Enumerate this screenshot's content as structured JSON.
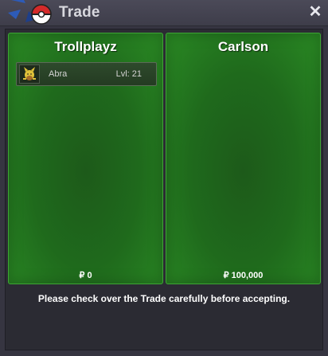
{
  "window": {
    "title": "Trade",
    "close_icon": "close-icon",
    "title_icon": "pokeball-arrows-icon"
  },
  "left_panel": {
    "player_name": "Trollplayz",
    "items": [
      {
        "name": "Abra",
        "level": "Lvl: 21",
        "icon": "abra-sprite-icon"
      }
    ],
    "money": "₽ 0"
  },
  "right_panel": {
    "player_name": "Carlson",
    "items": [],
    "money": "₽ 100,000"
  },
  "footer": {
    "message": "Please check over the Trade carefully before accepting."
  },
  "colors": {
    "panel_green": "#1f6a1c",
    "panel_border": "#3da534",
    "window_bg": "#363541"
  }
}
